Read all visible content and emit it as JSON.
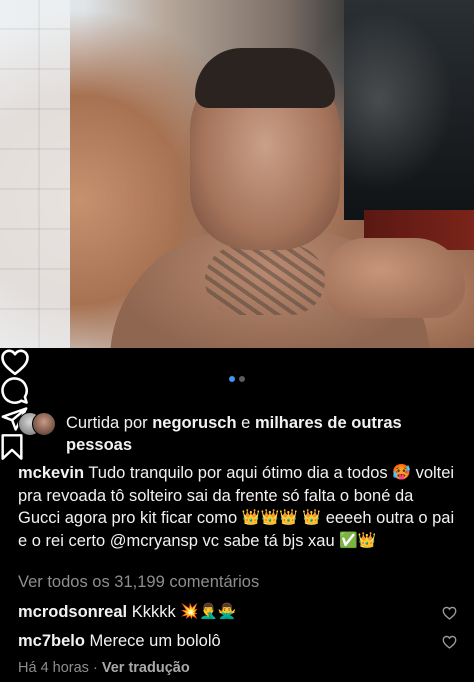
{
  "post": {
    "liked_prefix": "Curtida por",
    "liked_user": "negorusch",
    "liked_middle": "e",
    "liked_rest": "milhares de outras pessoas",
    "author": "mckevin",
    "caption_part1": "Tudo tranquilo por aqui ótimo dia a todos",
    "caption_part2": "voltei pra revoada tô solteiro sai da frente só falta o boné da Gucci agora pro kit ficar como",
    "caption_part3": "eeeeh outra o pai e o rei certo @mcryansp vc sabe tá bjs xau",
    "emoji_face": "🥵",
    "emoji_crown": "👑",
    "emoji_check": "✅",
    "view_all": "Ver todos os 31,199 comentários",
    "comments": [
      {
        "user": "mcrodsonreal",
        "text": "Kkkkk",
        "emojis": "💥🤦‍♂️🙅‍♂️"
      },
      {
        "user": "mc7belo",
        "text": "Merece um bololô",
        "emojis": ""
      }
    ],
    "time": "Há 4 horas",
    "separator": "·",
    "translate": "Ver tradução",
    "carousel_index": 1,
    "carousel_count": 2
  },
  "icons": {
    "like": "heart-icon",
    "comment": "comment-icon",
    "share": "send-icon",
    "save": "bookmark-icon",
    "comment_like": "heart-icon"
  },
  "colors": {
    "background": "#000000",
    "text": "#f2f2f2",
    "muted": "#8e8e8e",
    "carousel_active": "#3d95f5",
    "carousel_inactive": "#5b5b5b"
  }
}
